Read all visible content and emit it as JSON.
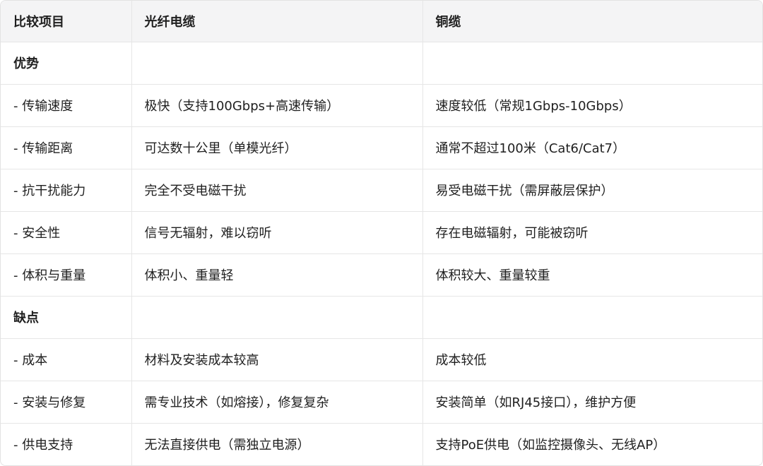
{
  "header": {
    "col1": "比较项目",
    "col2": "光纤电缆",
    "col3": "铜缆"
  },
  "sections": {
    "advantages": "优势",
    "disadvantages": "缺点"
  },
  "rows": [
    {
      "item": "- 传输速度",
      "fiber": "极快（支持100Gbps+高速传输）",
      "copper": "速度较低（常规1Gbps-10Gbps）"
    },
    {
      "item": "- 传输距离",
      "fiber": "可达数十公里（单模光纤）",
      "copper": "通常不超过100米（Cat6/Cat7）"
    },
    {
      "item": "- 抗干扰能力",
      "fiber": "完全不受电磁干扰",
      "copper": "易受电磁干扰（需屏蔽层保护）"
    },
    {
      "item": "- 安全性",
      "fiber": "信号无辐射，难以窃听",
      "copper": "存在电磁辐射，可能被窃听"
    },
    {
      "item": "- 体积与重量",
      "fiber": "体积小、重量轻",
      "copper": "体积较大、重量较重"
    },
    {
      "item": "- 成本",
      "fiber": "材料及安装成本较高",
      "copper": "成本较低"
    },
    {
      "item": "- 安装与修复",
      "fiber": "需专业技术（如熔接），修复复杂",
      "copper": "安装简单（如RJ45接口），维护方便"
    },
    {
      "item": "- 供电支持",
      "fiber": "无法直接供电（需独立电源）",
      "copper": "支持PoE供电（如监控摄像头、无线AP）"
    }
  ]
}
